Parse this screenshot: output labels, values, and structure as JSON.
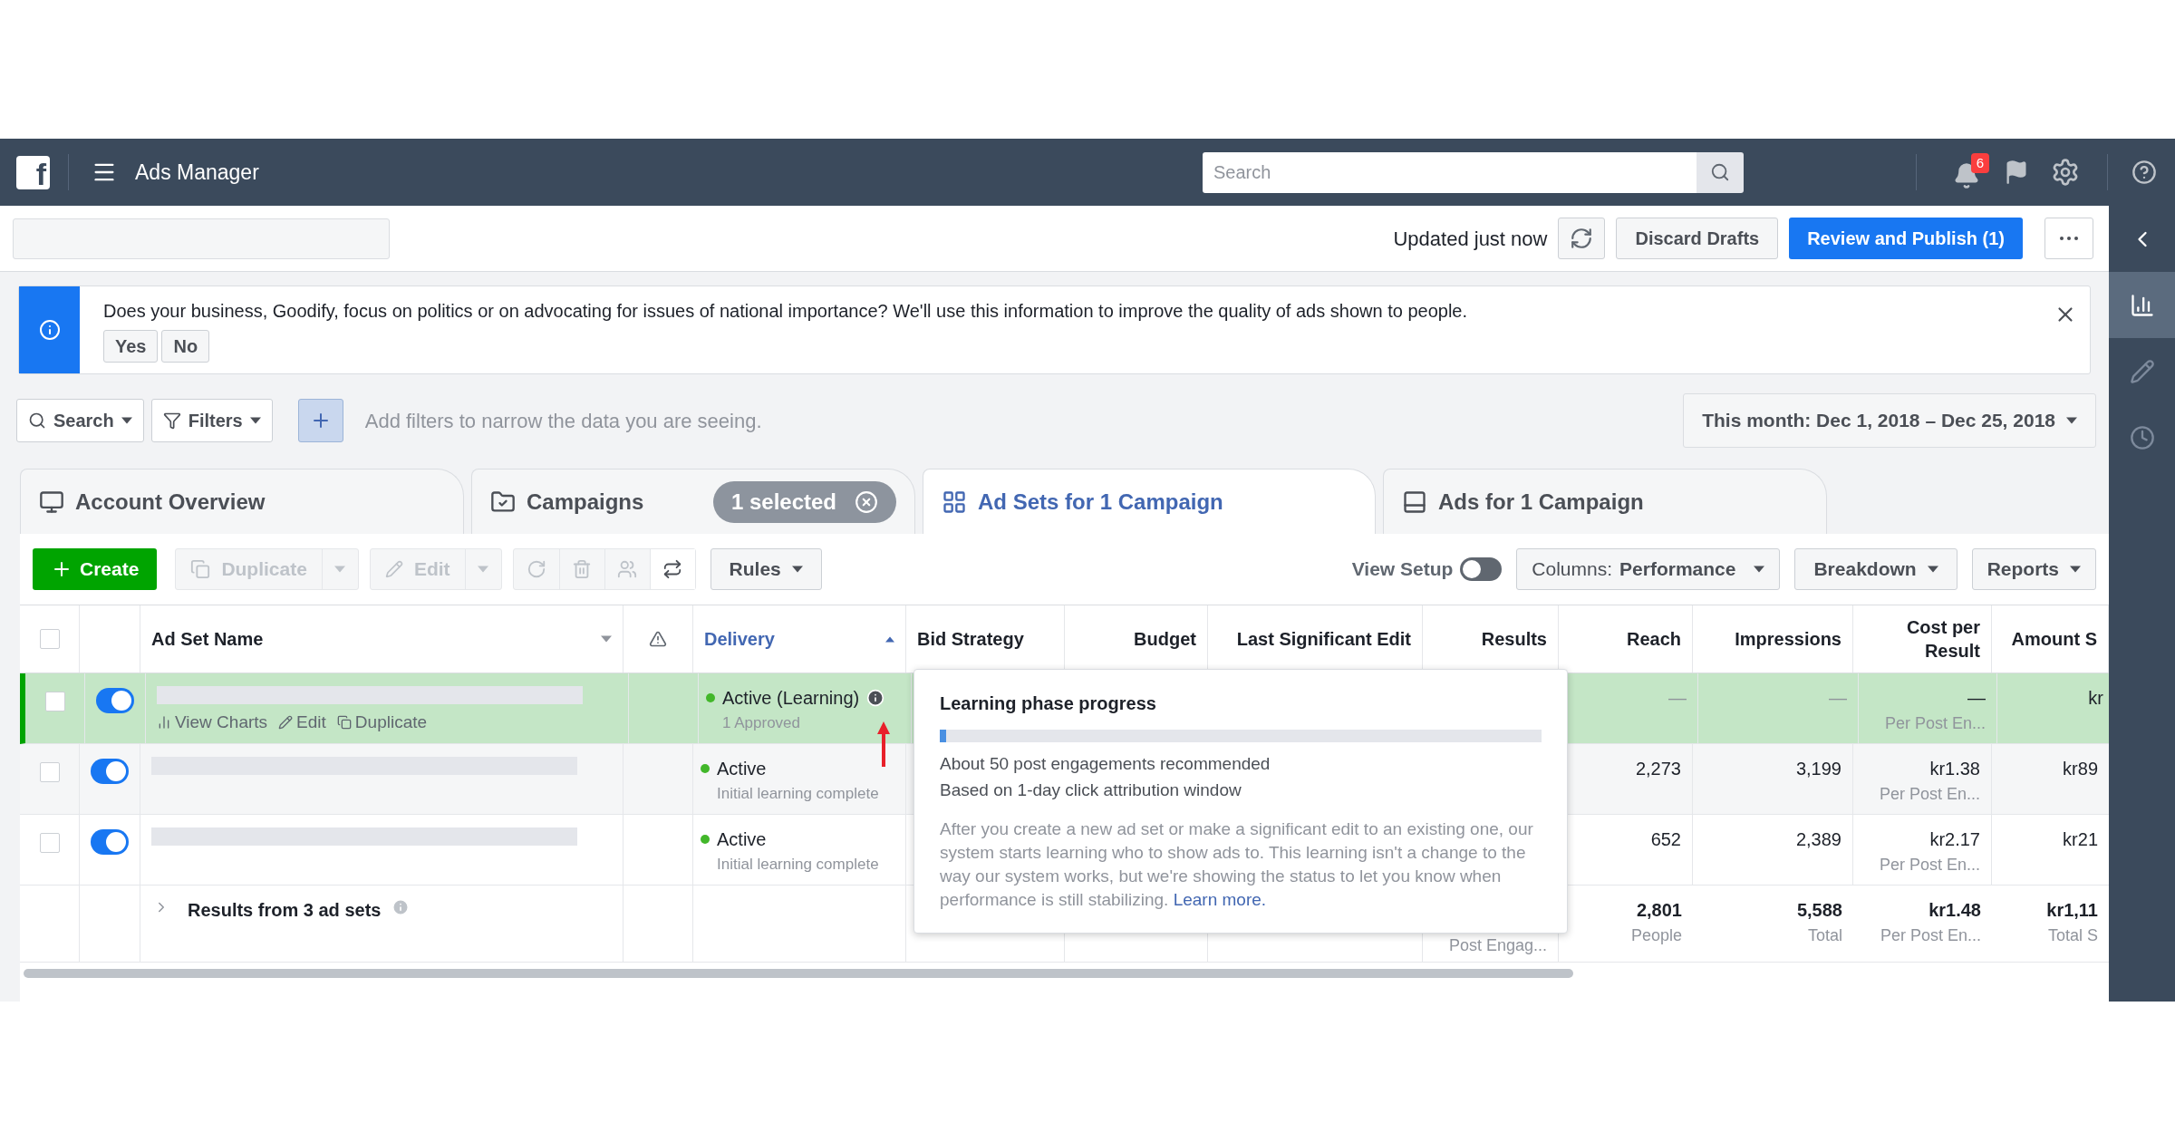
{
  "topbar": {
    "logo": "f",
    "title": "Ads Manager",
    "search_placeholder": "Search",
    "notification_count": "6"
  },
  "toolbar": {
    "status": "Updated just now",
    "discard": "Discard Drafts",
    "publish": "Review and Publish (1)"
  },
  "banner": {
    "text": "Does your business, Goodify, focus on politics or on advocating for issues of national importance? We'll use this information to improve the quality of ads shown to people.",
    "buttons": [
      "Yes",
      "No"
    ]
  },
  "filters": {
    "search": "Search",
    "filters": "Filters",
    "placeholder": "Add filters to narrow the data you are seeing.",
    "date_range": "This month: Dec 1, 2018 – Dec 25, 2018"
  },
  "tabs": [
    {
      "kind": "account",
      "label": "Account Overview",
      "selected": false
    },
    {
      "kind": "campaigns",
      "label": "Campaigns",
      "selected": false,
      "badge": "1 selected"
    },
    {
      "kind": "adsets",
      "label": "Ad Sets for 1 Campaign",
      "selected": true
    },
    {
      "kind": "ads",
      "label": "Ads for 1 Campaign",
      "selected": false
    }
  ],
  "actions": {
    "create": "Create",
    "duplicate": "Duplicate",
    "edit": "Edit",
    "rules": "Rules",
    "view_setup": {
      "label": "View Setup",
      "on": false
    },
    "columns_label": "Columns:",
    "columns_value": "Performance",
    "breakdown": "Breakdown",
    "reports": "Reports"
  },
  "table": {
    "select_all": false,
    "columns": [
      {
        "label": "Ad Set Name",
        "sorted": false
      },
      {
        "label": "Delivery",
        "sorted": true
      },
      {
        "label": "Bid Strategy",
        "sorted": false
      },
      {
        "label": "Budget",
        "sorted": false
      },
      {
        "label": "Last Significant Edit",
        "sorted": false
      },
      {
        "label": "Results",
        "sorted": false
      },
      {
        "label": "Reach",
        "sorted": false
      },
      {
        "label": "Impressions",
        "sorted": false
      },
      {
        "label": "Cost per Result",
        "sorted": false
      },
      {
        "label": "Amount S",
        "sorted": false
      }
    ],
    "rows": [
      {
        "selected": true,
        "checked": false,
        "on": true,
        "links": [
          "View Charts",
          "Edit",
          "Duplicate"
        ],
        "delivery": "Active (Learning)",
        "delivery_sub": "1 Approved",
        "reach": "—",
        "impressions": "—",
        "cost": "—",
        "cost_sub": "Per Post En...",
        "amount": "kr"
      },
      {
        "selected": false,
        "checked": false,
        "on": true,
        "delivery": "Active",
        "delivery_sub": "Initial learning complete",
        "reach": "2,273",
        "impressions": "3,199",
        "cost": "kr1.38",
        "cost_sub": "Per Post En...",
        "amount": "kr89"
      },
      {
        "selected": false,
        "checked": false,
        "on": true,
        "delivery": "Active",
        "delivery_sub": "Initial learning complete",
        "reach": "652",
        "impressions": "2,389",
        "cost": "kr2.17",
        "cost_sub": "Per Post En...",
        "amount": "kr21"
      }
    ],
    "summary": {
      "label": "Results from 3 ad sets",
      "results_sub": "Post Engag...",
      "reach": "2,801",
      "reach_sub": "People",
      "impressions": "5,588",
      "impressions_sub": "Total",
      "cost": "kr1.48",
      "cost_sub": "Per Post En...",
      "amount": "kr1,11",
      "amount_sub": "Total S"
    }
  },
  "tooltip": {
    "title": "Learning phase progress",
    "level": 0.01,
    "lines": [
      "About 50 post engagements recommended",
      "Based on 1-day click attribution window"
    ],
    "paragraph": "After you create a new ad set or make a significant edit to an existing one, our system starts learning who to show ads to. This learning isn't a change to the way our system works, but we're showing the status to let you know when performance is still stabilizing.",
    "link": "Learn more."
  },
  "rail": [
    {
      "kind": "collapse",
      "selected": false
    },
    {
      "kind": "chart",
      "selected": true
    },
    {
      "kind": "edit",
      "selected": false
    },
    {
      "kind": "history",
      "selected": false
    }
  ]
}
